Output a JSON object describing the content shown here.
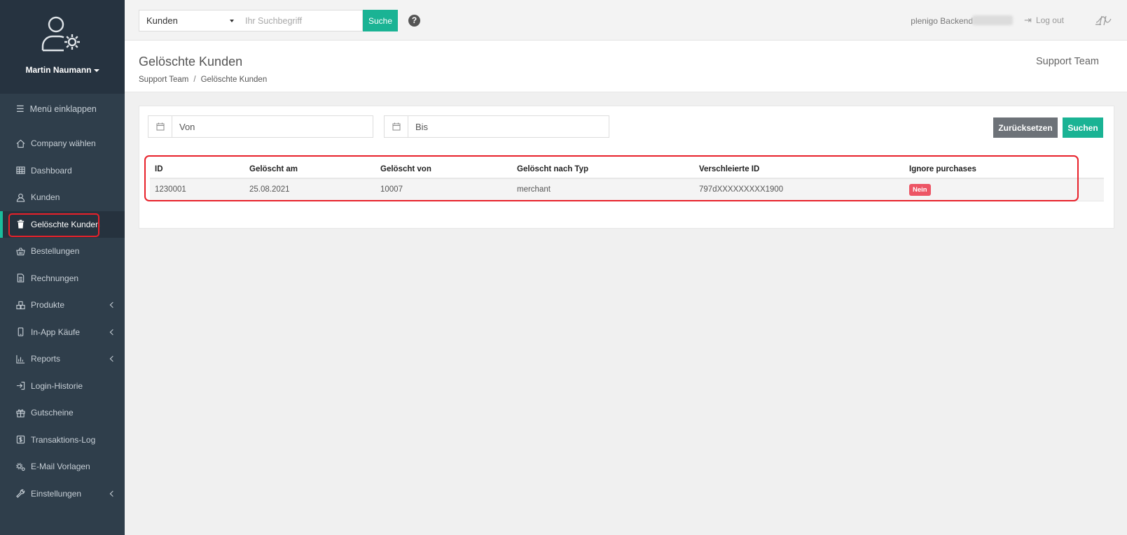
{
  "sidebar": {
    "user_name": "Martin Naumann",
    "avatar_icon": "user-gear-icon",
    "collapse_label": "Menü einklappen",
    "items": [
      {
        "label": "Company wählen",
        "icon": "home-icon",
        "has_submenu": false
      },
      {
        "label": "Dashboard",
        "icon": "grid-icon",
        "has_submenu": false
      },
      {
        "label": "Kunden",
        "icon": "user-icon",
        "has_submenu": false
      },
      {
        "label": "Gelöschte Kunden",
        "icon": "trash-icon",
        "has_submenu": false,
        "active": true
      },
      {
        "label": "Bestellungen",
        "icon": "basket-icon",
        "has_submenu": false
      },
      {
        "label": "Rechnungen",
        "icon": "document-icon",
        "has_submenu": false
      },
      {
        "label": "Produkte",
        "icon": "boxes-icon",
        "has_submenu": true
      },
      {
        "label": "In-App Käufe",
        "icon": "mobile-icon",
        "has_submenu": true
      },
      {
        "label": "Reports",
        "icon": "bar-chart-icon",
        "has_submenu": true
      },
      {
        "label": "Login-Historie",
        "icon": "sign-in-icon",
        "has_submenu": false
      },
      {
        "label": "Gutscheine",
        "icon": "gift-icon",
        "has_submenu": false
      },
      {
        "label": "Transaktions-Log",
        "icon": "dollar-icon",
        "has_submenu": false
      },
      {
        "label": "E-Mail Vorlagen",
        "icon": "gears-icon",
        "has_submenu": false
      },
      {
        "label": "Einstellungen",
        "icon": "wrench-icon",
        "has_submenu": true
      }
    ]
  },
  "topbar": {
    "search_scope": "Kunden",
    "search_placeholder": "Ihr Suchbegriff",
    "search_button": "Suche",
    "help_icon": "question-circle-icon",
    "backend_label": "plenigo Backend",
    "logout_label": "Log out",
    "logo_icon": "plenigo-logo-icon"
  },
  "page": {
    "title": "Gelöschte Kunden",
    "breadcrumb": [
      "Support Team",
      "Gelöschte Kunden"
    ],
    "team_name": "Support Team"
  },
  "filters": {
    "from_placeholder": "Von",
    "to_placeholder": "Bis",
    "reset_button": "Zurücksetzen",
    "search_button": "Suchen"
  },
  "table": {
    "columns": [
      "ID",
      "Gelöscht am",
      "Gelöscht von",
      "Gelöscht nach Typ",
      "Verschleierte ID",
      "Ignore purchases"
    ],
    "rows": [
      {
        "id": "1230001",
        "deleted_at": "25.08.2021",
        "deleted_by": "10007",
        "deleted_type": "merchant",
        "obfuscated_id": "797dXXXXXXXXX1900",
        "ignore_purchases": "Nein"
      }
    ]
  },
  "colors": {
    "sidebar_bg": "#2f3e4b",
    "accent": "#1ab394",
    "highlight_border": "#e8212a",
    "badge_red": "#ed5565",
    "reset_button": "#6d7278"
  }
}
